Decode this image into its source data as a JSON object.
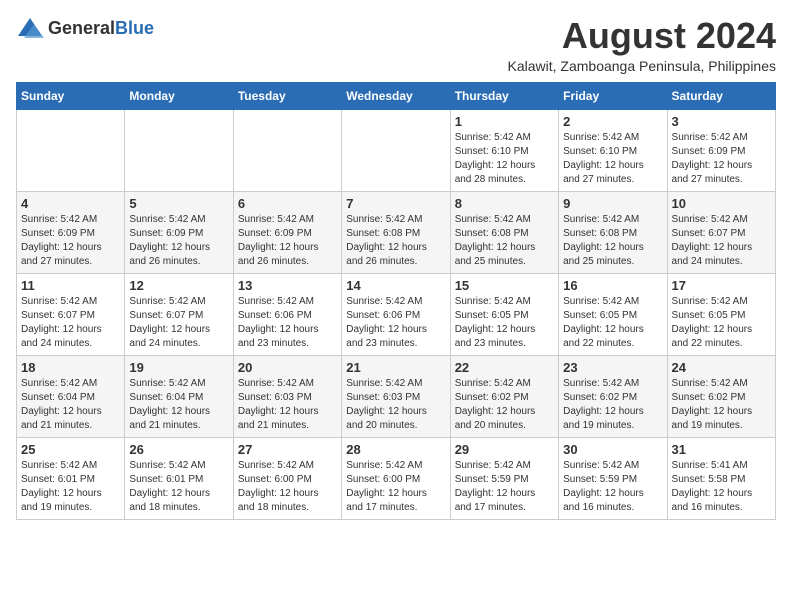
{
  "logo": {
    "general": "General",
    "blue": "Blue"
  },
  "title": "August 2024",
  "subtitle": "Kalawit, Zamboanga Peninsula, Philippines",
  "header_days": [
    "Sunday",
    "Monday",
    "Tuesday",
    "Wednesday",
    "Thursday",
    "Friday",
    "Saturday"
  ],
  "weeks": [
    [
      {
        "day": "",
        "info": ""
      },
      {
        "day": "",
        "info": ""
      },
      {
        "day": "",
        "info": ""
      },
      {
        "day": "",
        "info": ""
      },
      {
        "day": "1",
        "info": "Sunrise: 5:42 AM\nSunset: 6:10 PM\nDaylight: 12 hours\nand 28 minutes."
      },
      {
        "day": "2",
        "info": "Sunrise: 5:42 AM\nSunset: 6:10 PM\nDaylight: 12 hours\nand 27 minutes."
      },
      {
        "day": "3",
        "info": "Sunrise: 5:42 AM\nSunset: 6:09 PM\nDaylight: 12 hours\nand 27 minutes."
      }
    ],
    [
      {
        "day": "4",
        "info": "Sunrise: 5:42 AM\nSunset: 6:09 PM\nDaylight: 12 hours\nand 27 minutes."
      },
      {
        "day": "5",
        "info": "Sunrise: 5:42 AM\nSunset: 6:09 PM\nDaylight: 12 hours\nand 26 minutes."
      },
      {
        "day": "6",
        "info": "Sunrise: 5:42 AM\nSunset: 6:09 PM\nDaylight: 12 hours\nand 26 minutes."
      },
      {
        "day": "7",
        "info": "Sunrise: 5:42 AM\nSunset: 6:08 PM\nDaylight: 12 hours\nand 26 minutes."
      },
      {
        "day": "8",
        "info": "Sunrise: 5:42 AM\nSunset: 6:08 PM\nDaylight: 12 hours\nand 25 minutes."
      },
      {
        "day": "9",
        "info": "Sunrise: 5:42 AM\nSunset: 6:08 PM\nDaylight: 12 hours\nand 25 minutes."
      },
      {
        "day": "10",
        "info": "Sunrise: 5:42 AM\nSunset: 6:07 PM\nDaylight: 12 hours\nand 24 minutes."
      }
    ],
    [
      {
        "day": "11",
        "info": "Sunrise: 5:42 AM\nSunset: 6:07 PM\nDaylight: 12 hours\nand 24 minutes."
      },
      {
        "day": "12",
        "info": "Sunrise: 5:42 AM\nSunset: 6:07 PM\nDaylight: 12 hours\nand 24 minutes."
      },
      {
        "day": "13",
        "info": "Sunrise: 5:42 AM\nSunset: 6:06 PM\nDaylight: 12 hours\nand 23 minutes."
      },
      {
        "day": "14",
        "info": "Sunrise: 5:42 AM\nSunset: 6:06 PM\nDaylight: 12 hours\nand 23 minutes."
      },
      {
        "day": "15",
        "info": "Sunrise: 5:42 AM\nSunset: 6:05 PM\nDaylight: 12 hours\nand 23 minutes."
      },
      {
        "day": "16",
        "info": "Sunrise: 5:42 AM\nSunset: 6:05 PM\nDaylight: 12 hours\nand 22 minutes."
      },
      {
        "day": "17",
        "info": "Sunrise: 5:42 AM\nSunset: 6:05 PM\nDaylight: 12 hours\nand 22 minutes."
      }
    ],
    [
      {
        "day": "18",
        "info": "Sunrise: 5:42 AM\nSunset: 6:04 PM\nDaylight: 12 hours\nand 21 minutes."
      },
      {
        "day": "19",
        "info": "Sunrise: 5:42 AM\nSunset: 6:04 PM\nDaylight: 12 hours\nand 21 minutes."
      },
      {
        "day": "20",
        "info": "Sunrise: 5:42 AM\nSunset: 6:03 PM\nDaylight: 12 hours\nand 21 minutes."
      },
      {
        "day": "21",
        "info": "Sunrise: 5:42 AM\nSunset: 6:03 PM\nDaylight: 12 hours\nand 20 minutes."
      },
      {
        "day": "22",
        "info": "Sunrise: 5:42 AM\nSunset: 6:02 PM\nDaylight: 12 hours\nand 20 minutes."
      },
      {
        "day": "23",
        "info": "Sunrise: 5:42 AM\nSunset: 6:02 PM\nDaylight: 12 hours\nand 19 minutes."
      },
      {
        "day": "24",
        "info": "Sunrise: 5:42 AM\nSunset: 6:02 PM\nDaylight: 12 hours\nand 19 minutes."
      }
    ],
    [
      {
        "day": "25",
        "info": "Sunrise: 5:42 AM\nSunset: 6:01 PM\nDaylight: 12 hours\nand 19 minutes."
      },
      {
        "day": "26",
        "info": "Sunrise: 5:42 AM\nSunset: 6:01 PM\nDaylight: 12 hours\nand 18 minutes."
      },
      {
        "day": "27",
        "info": "Sunrise: 5:42 AM\nSunset: 6:00 PM\nDaylight: 12 hours\nand 18 minutes."
      },
      {
        "day": "28",
        "info": "Sunrise: 5:42 AM\nSunset: 6:00 PM\nDaylight: 12 hours\nand 17 minutes."
      },
      {
        "day": "29",
        "info": "Sunrise: 5:42 AM\nSunset: 5:59 PM\nDaylight: 12 hours\nand 17 minutes."
      },
      {
        "day": "30",
        "info": "Sunrise: 5:42 AM\nSunset: 5:59 PM\nDaylight: 12 hours\nand 16 minutes."
      },
      {
        "day": "31",
        "info": "Sunrise: 5:41 AM\nSunset: 5:58 PM\nDaylight: 12 hours\nand 16 minutes."
      }
    ]
  ]
}
